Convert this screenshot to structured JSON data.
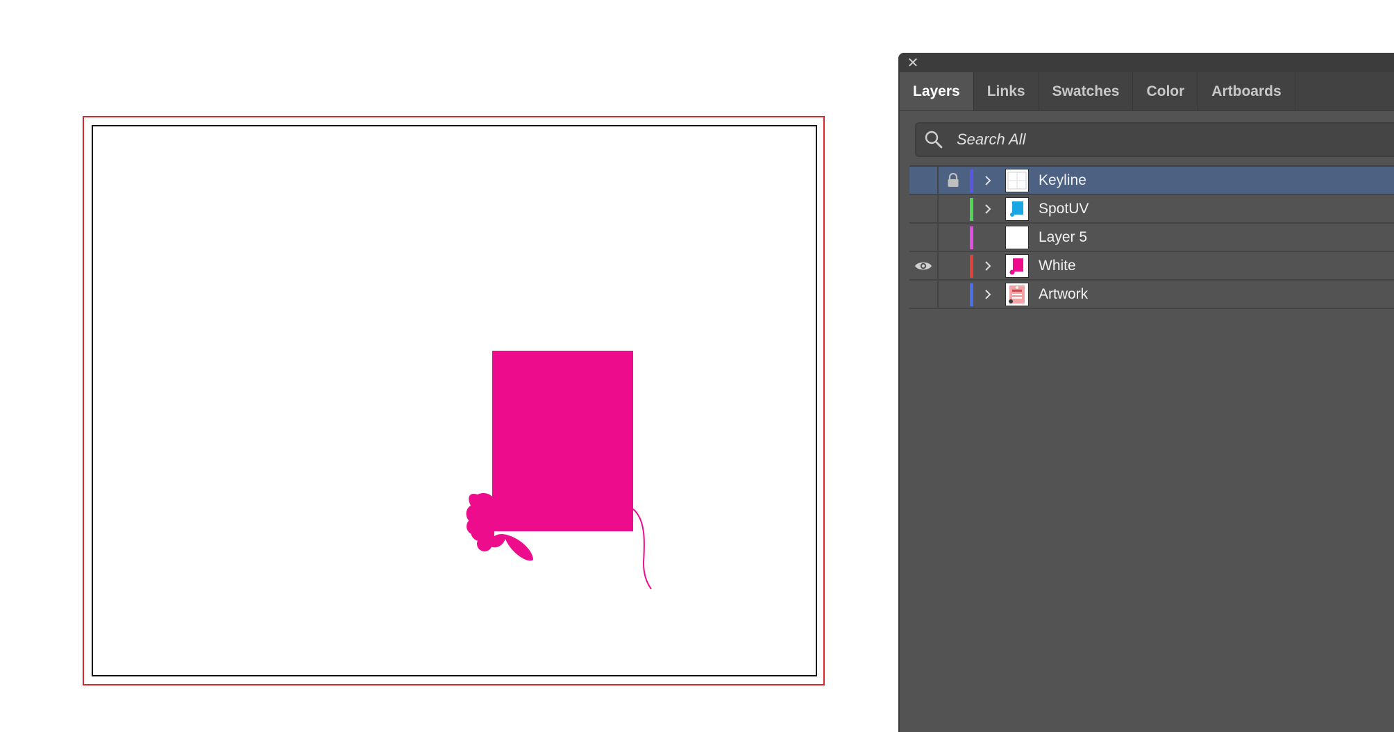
{
  "panel": {
    "close_glyph": "✕",
    "tabs": [
      {
        "label": "Layers",
        "active": true
      },
      {
        "label": "Links",
        "active": false
      },
      {
        "label": "Swatches",
        "active": false
      },
      {
        "label": "Color",
        "active": false
      },
      {
        "label": "Artboards",
        "active": false
      }
    ],
    "search": {
      "placeholder": "Search All",
      "value": ""
    },
    "layers": [
      {
        "name": "Keyline",
        "color": "#5b56e6",
        "visible": false,
        "locked": true,
        "expandable": true,
        "selected": true,
        "thumb": "keyline-thumbnail"
      },
      {
        "name": "SpotUV",
        "color": "#4fd656",
        "visible": false,
        "locked": false,
        "expandable": true,
        "selected": false,
        "thumb": "spotuv-thumbnail"
      },
      {
        "name": "Layer 5",
        "color": "#e04fe0",
        "visible": false,
        "locked": false,
        "expandable": false,
        "selected": false,
        "thumb": "blank-thumbnail"
      },
      {
        "name": "White",
        "color": "#e2403a",
        "visible": true,
        "locked": false,
        "expandable": true,
        "selected": false,
        "thumb": "white-thumbnail"
      },
      {
        "name": "Artwork",
        "color": "#4a6fe8",
        "visible": false,
        "locked": false,
        "expandable": true,
        "selected": false,
        "thumb": "artwork-thumbnail"
      }
    ]
  },
  "canvas": {
    "bleed_color": "#d9262c",
    "trim_color": "#111111",
    "art_color": "#ec0c8c"
  }
}
